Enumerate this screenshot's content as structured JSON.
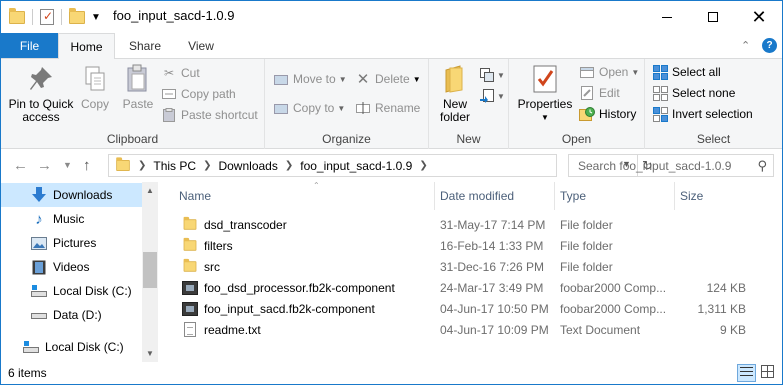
{
  "window": {
    "title": "foo_input_sacd-1.0.9"
  },
  "tabs": {
    "file": "File",
    "home": "Home",
    "share": "Share",
    "view": "View"
  },
  "ribbon": {
    "clipboard": {
      "label": "Clipboard",
      "pin_label": "Pin to Quick access",
      "pin_line1": "Pin to Quick",
      "pin_line2": "access",
      "copy": "Copy",
      "paste": "Paste",
      "cut": "Cut",
      "copy_path": "Copy path",
      "paste_shortcut": "Paste shortcut"
    },
    "organize": {
      "label": "Organize",
      "move_to": "Move to",
      "copy_to": "Copy to",
      "delete": "Delete",
      "rename": "Rename"
    },
    "new": {
      "label": "New",
      "new_folder_line1": "New",
      "new_folder_line2": "folder"
    },
    "open": {
      "label": "Open",
      "properties": "Properties",
      "open": "Open",
      "edit": "Edit",
      "history": "History"
    },
    "select": {
      "label": "Select",
      "select_all": "Select all",
      "select_none": "Select none",
      "invert_selection": "Invert selection"
    }
  },
  "address": {
    "crumbs": [
      "This PC",
      "Downloads",
      "foo_input_sacd-1.0.9"
    ],
    "search_placeholder": "Search foo_input_sacd-1.0.9"
  },
  "navpane": {
    "items": [
      {
        "label": "Downloads",
        "icon": "download-arrow-icon",
        "selected": true
      },
      {
        "label": "Music",
        "icon": "music-note-icon"
      },
      {
        "label": "Pictures",
        "icon": "pictures-icon"
      },
      {
        "label": "Videos",
        "icon": "videos-icon"
      },
      {
        "label": "Local Disk (C:)",
        "icon": "system-drive-icon"
      },
      {
        "label": "Data (D:)",
        "icon": "drive-icon"
      },
      {
        "label": "Local Disk (C:)",
        "icon": "system-drive-icon"
      }
    ]
  },
  "columns": {
    "name": "Name",
    "date": "Date modified",
    "type": "Type",
    "size": "Size"
  },
  "files": [
    {
      "name": "dsd_transcoder",
      "date": "31-May-17 7:14 PM",
      "type": "File folder",
      "size": "",
      "icon": "folder-icon"
    },
    {
      "name": "filters",
      "date": "16-Feb-14 1:33 PM",
      "type": "File folder",
      "size": "",
      "icon": "folder-icon"
    },
    {
      "name": "src",
      "date": "31-Dec-16 7:26 PM",
      "type": "File folder",
      "size": "",
      "icon": "folder-icon"
    },
    {
      "name": "foo_dsd_processor.fb2k-component",
      "date": "24-Mar-17 3:49 PM",
      "type": "foobar2000 Comp...",
      "size": "124 KB",
      "icon": "component-file-icon"
    },
    {
      "name": "foo_input_sacd.fb2k-component",
      "date": "04-Jun-17 10:50 PM",
      "type": "foobar2000 Comp...",
      "size": "1,311 KB",
      "icon": "component-file-icon"
    },
    {
      "name": "readme.txt",
      "date": "04-Jun-17 10:09 PM",
      "type": "Text Document",
      "size": "9 KB",
      "icon": "text-file-icon"
    }
  ],
  "status": {
    "items_count": "6 items"
  },
  "colors": {
    "accent": "#1979ca",
    "selection": "#cce8ff",
    "folder": "#f8d775"
  }
}
